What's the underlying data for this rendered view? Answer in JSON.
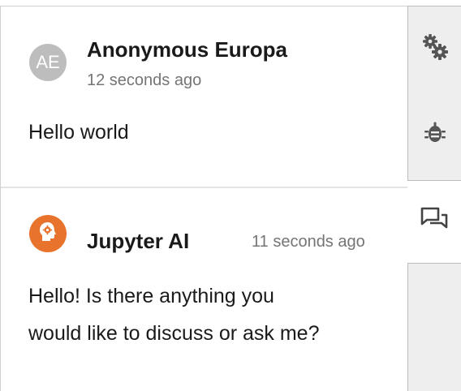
{
  "messages": [
    {
      "avatar_initials": "AE",
      "sender": "Anonymous Europa",
      "timestamp": "12 seconds ago",
      "body_lines": [
        "Hello world"
      ]
    },
    {
      "avatar_icon": "head-gear-icon",
      "sender": "Jupyter AI",
      "timestamp": "11 seconds ago",
      "body_lines": [
        "Hello! Is there anything you",
        "would like to discuss or ask me?"
      ]
    }
  ],
  "sidebar": {
    "tabs": [
      {
        "icon": "gears-icon"
      },
      {
        "icon": "bug-icon"
      },
      {
        "icon": "chat-icon",
        "active": true
      }
    ]
  },
  "colors": {
    "ai_avatar": "#e8732c",
    "user_avatar": "#bdbdbd",
    "timestamp": "#757575",
    "sidebar_bg": "#eeeeee"
  }
}
